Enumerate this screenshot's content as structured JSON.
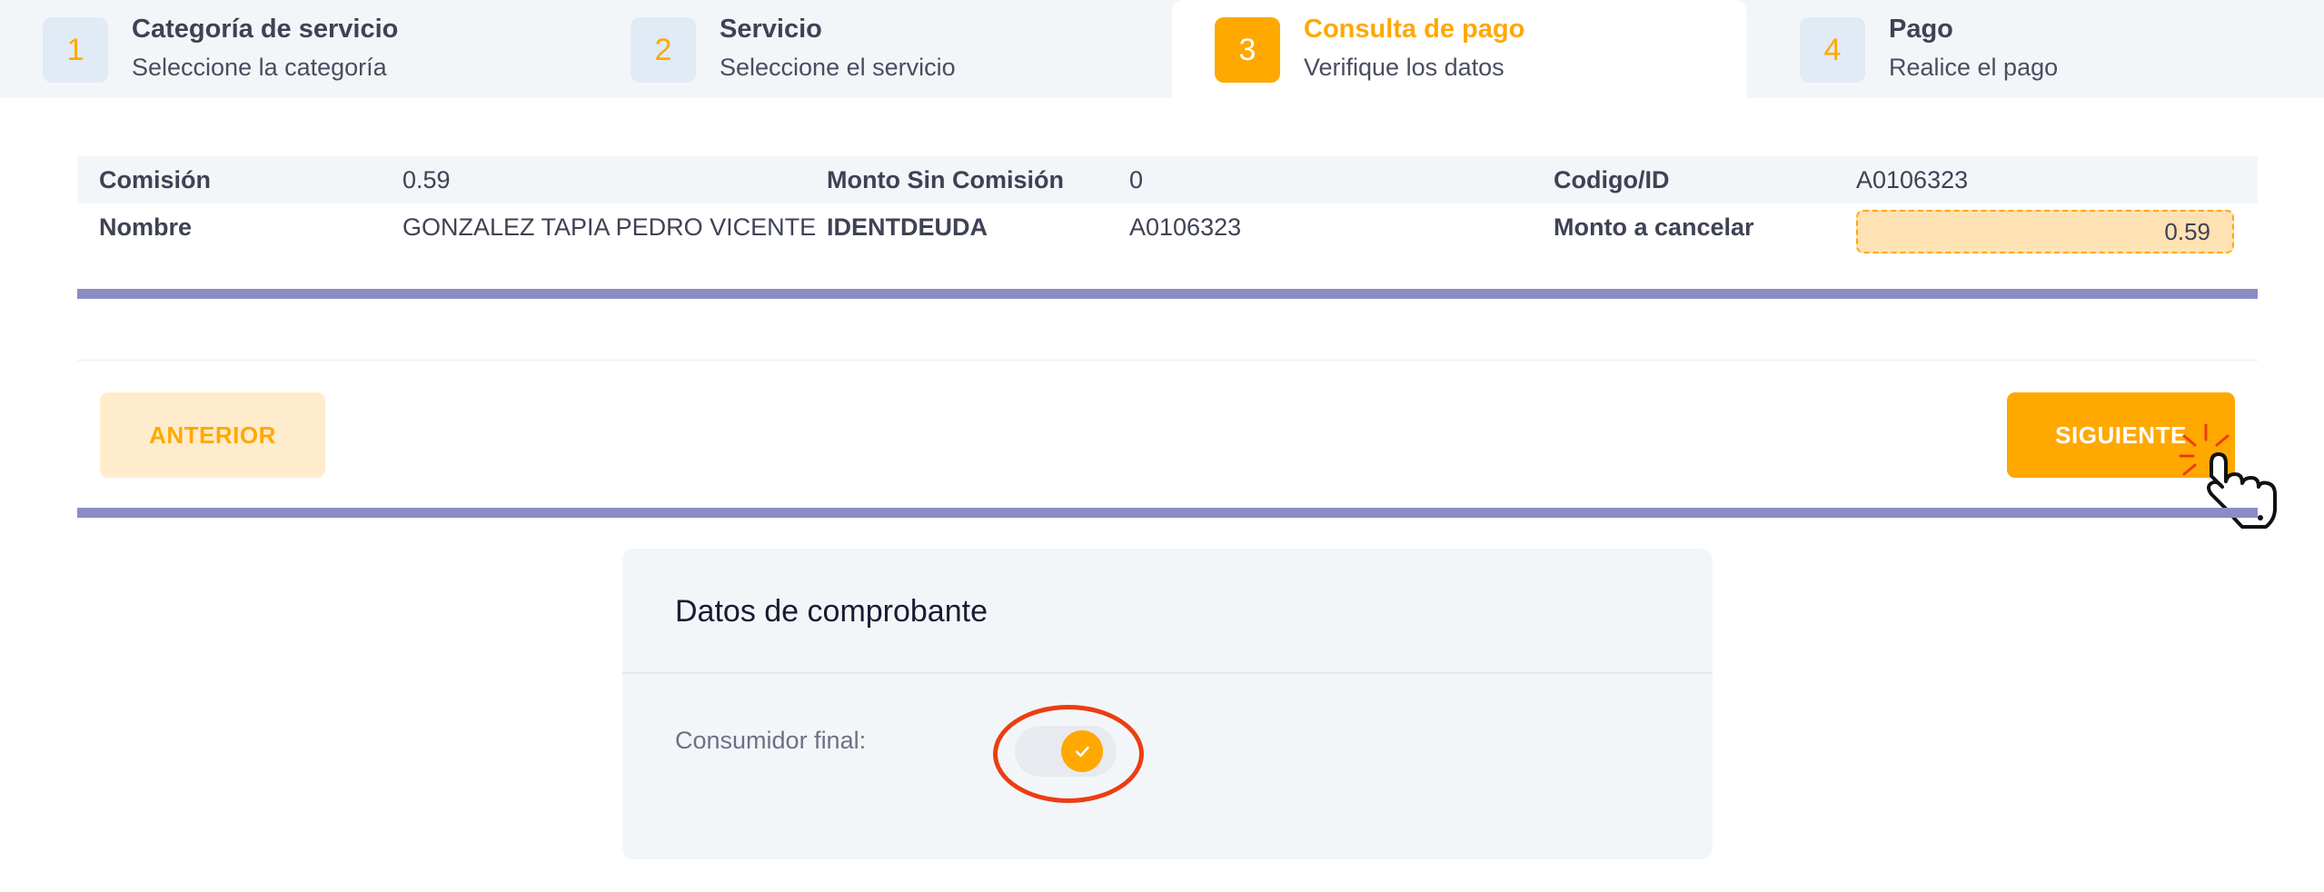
{
  "stepper": {
    "steps": [
      {
        "number": "1",
        "title": "Categoría de servicio",
        "subtitle": "Seleccione la categoría"
      },
      {
        "number": "2",
        "title": "Servicio",
        "subtitle": "Seleccione el servicio"
      },
      {
        "number": "3",
        "title": "Consulta de pago",
        "subtitle": "Verifique los datos",
        "active": true
      },
      {
        "number": "4",
        "title": "Pago",
        "subtitle": "Realice el pago"
      }
    ]
  },
  "details": {
    "comision_label": "Comisión",
    "comision_value": "0.59",
    "monto_sin_comision_label": "Monto Sin Comisión",
    "monto_sin_comision_value": "0",
    "codigo_label": "Codigo/ID",
    "codigo_value": "A0106323",
    "nombre_label": "Nombre",
    "nombre_value": "GONZALEZ TAPIA PEDRO VICENTE",
    "identdeuda_label": "IDENTDEUDA",
    "identdeuda_value": "A0106323",
    "monto_cancelar_label": "Monto a cancelar",
    "monto_cancelar_value": "0.59"
  },
  "nav": {
    "prev_label": "ANTERIOR",
    "next_label": "SIGUIENTE"
  },
  "comprobante": {
    "title": "Datos de comprobante",
    "consumidor_final_label": "Consumidor final:",
    "consumidor_final_on": true
  },
  "colors": {
    "accent": "#ffa800",
    "divider_bar": "#8c8cc4",
    "highlight": "#ec3d12"
  },
  "icons": {
    "toggle_check": "check-icon",
    "cursor": "hand-pointer-icon"
  }
}
